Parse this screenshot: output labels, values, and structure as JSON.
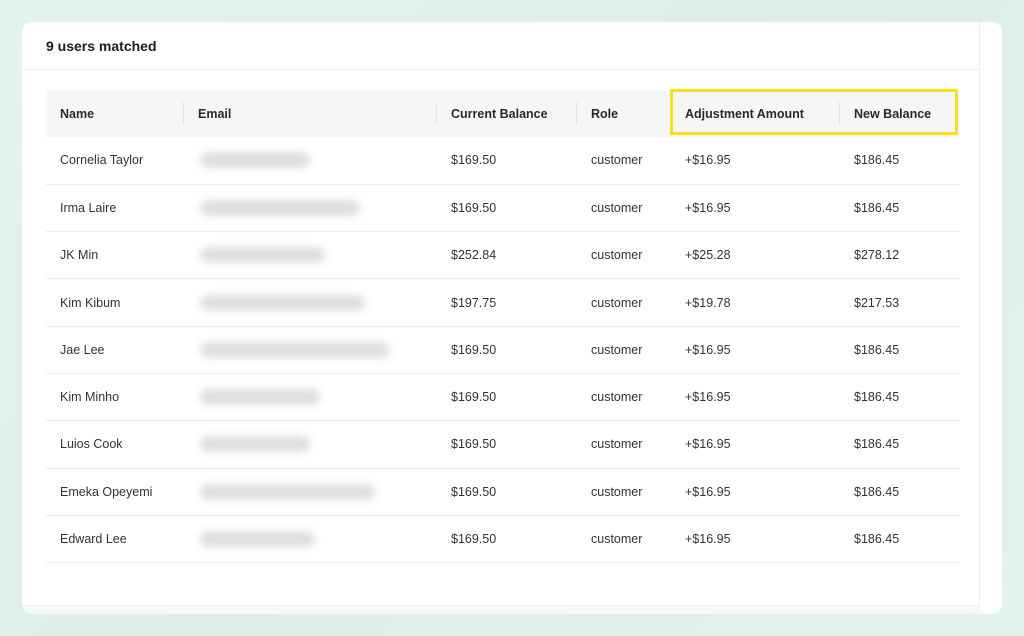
{
  "header": {
    "matched_text": "9 users matched"
  },
  "table": {
    "columns": [
      {
        "label": "Name"
      },
      {
        "label": "Email"
      },
      {
        "label": "Current Balance"
      },
      {
        "label": "Role"
      },
      {
        "label": "Adjustment Amount"
      },
      {
        "label": "New Balance"
      }
    ],
    "rows": [
      {
        "name": "Cornelia Taylor",
        "current_balance": "$169.50",
        "role": "customer",
        "adjustment": "+$16.95",
        "new_balance": "$186.45"
      },
      {
        "name": "Irma Laire",
        "current_balance": "$169.50",
        "role": "customer",
        "adjustment": "+$16.95",
        "new_balance": "$186.45"
      },
      {
        "name": "JK Min",
        "current_balance": "$252.84",
        "role": "customer",
        "adjustment": "+$25.28",
        "new_balance": "$278.12"
      },
      {
        "name": "Kim Kibum",
        "current_balance": "$197.75",
        "role": "customer",
        "adjustment": "+$19.78",
        "new_balance": "$217.53"
      },
      {
        "name": "Jae Lee",
        "current_balance": "$169.50",
        "role": "customer",
        "adjustment": "+$16.95",
        "new_balance": "$186.45"
      },
      {
        "name": "Kim Minho",
        "current_balance": "$169.50",
        "role": "customer",
        "adjustment": "+$16.95",
        "new_balance": "$186.45"
      },
      {
        "name": "Luios Cook",
        "current_balance": "$169.50",
        "role": "customer",
        "adjustment": "+$16.95",
        "new_balance": "$186.45"
      },
      {
        "name": "Emeka Opeyemi",
        "current_balance": "$169.50",
        "role": "customer",
        "adjustment": "+$16.95",
        "new_balance": "$186.45"
      },
      {
        "name": "Edward Lee",
        "current_balance": "$169.50",
        "role": "customer",
        "adjustment": "+$16.95",
        "new_balance": "$186.45"
      }
    ]
  },
  "colors": {
    "background": "#e0f2ea",
    "highlight": "#f3e21c",
    "header_row": "#f6f6f6"
  }
}
